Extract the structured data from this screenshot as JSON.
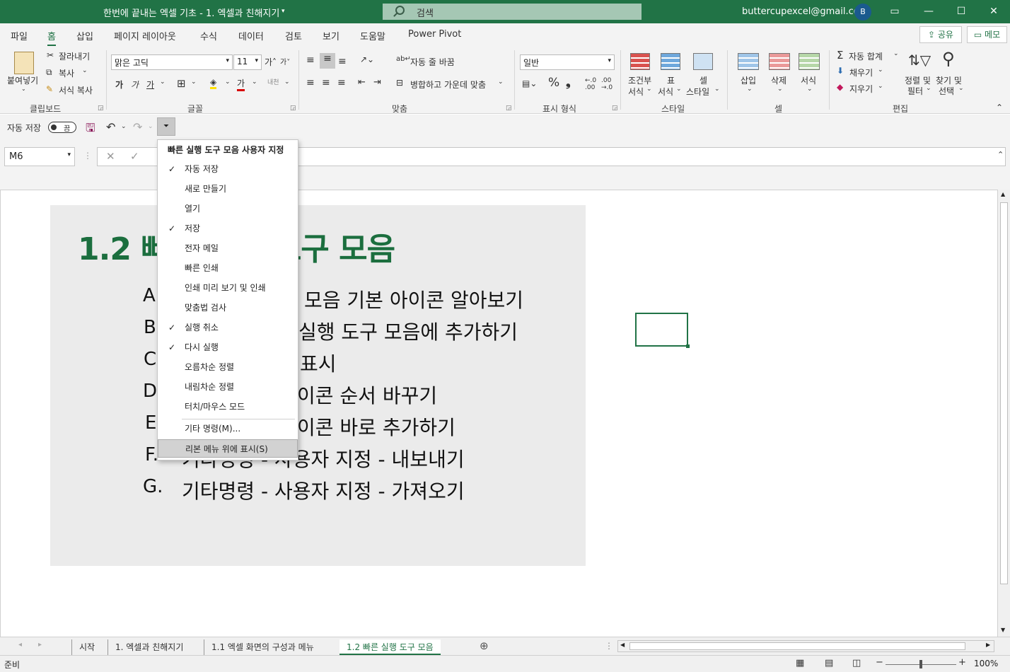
{
  "window": {
    "title": "한번에 끝내는 엑셀 기초 - 1. 엑셀과 친해지기",
    "search_placeholder": "검색",
    "account_email": "buttercupexcel@gmail.com",
    "avatar_initial": "B"
  },
  "menu_tabs": [
    "파일",
    "홈",
    "삽입",
    "페이지 레이아웃",
    "수식",
    "데이터",
    "검토",
    "보기",
    "도움말",
    "Power Pivot"
  ],
  "active_tab": "홈",
  "share_label": "공유",
  "memo_label": "메모",
  "ribbon": {
    "clipboard": {
      "paste": "붙여넣기",
      "cut": "잘라내기",
      "copy": "복사",
      "format_painter": "서식 복사",
      "group": "클립보드"
    },
    "font": {
      "name": "맑은 고딕",
      "size": "11",
      "bold": "가",
      "italic": "가",
      "underline": "가",
      "group": "글꼴"
    },
    "align": {
      "wrap": "자동 줄 바꿈",
      "merge": "병합하고 가운데 맞춤",
      "group": "맞춤"
    },
    "number": {
      "format": "일반",
      "group": "표시 형식"
    },
    "styles": {
      "cond1": "조건부",
      "cond2": "서식",
      "table1": "표",
      "table2": "서식",
      "cell1": "셀",
      "cell2": "스타일",
      "group": "스타일"
    },
    "cells": {
      "insert": "삽입",
      "delete": "삭제",
      "format": "서식",
      "group": "셀"
    },
    "edit": {
      "autosum": "자동 합계",
      "fill": "채우기",
      "clear": "지우기",
      "sort1": "정렬 및",
      "sort2": "필터",
      "find1": "찾기 및",
      "find2": "선택",
      "group": "편집"
    }
  },
  "qat": {
    "autosave_label": "자동 저장",
    "autosave_state": "끔"
  },
  "name_box": "M6",
  "slide": {
    "title": "1.2 빠른 실행 도구 모음",
    "letters": [
      "A",
      "B",
      "C",
      "D",
      "E",
      "F.",
      "G."
    ],
    "items_visible": [
      "모음 기본 아이콘 알아보기",
      "실행 도구 모음에 추가하기",
      "표시",
      "이콘 순서 바꾸기",
      "이콘 바로 추가하기",
      "기타명령 - 사용자 지정 - 내보내기",
      "기타명령 - 사용자 지정 - 가져오기"
    ]
  },
  "dropdown": {
    "header": "빠른 실행 도구 모음 사용자 지정",
    "items": [
      {
        "label": "자동 저장",
        "checked": true
      },
      {
        "label": "새로 만들기",
        "checked": false
      },
      {
        "label": "열기",
        "checked": false
      },
      {
        "label": "저장",
        "checked": true
      },
      {
        "label": "전자 메일",
        "checked": false
      },
      {
        "label": "빠른 인쇄",
        "checked": false
      },
      {
        "label": "인쇄 미리 보기 및 인쇄",
        "checked": false
      },
      {
        "label": "맞춤법 검사",
        "checked": false
      },
      {
        "label": "실행 취소",
        "checked": true
      },
      {
        "label": "다시 실행",
        "checked": true
      },
      {
        "label": "오름차순 정렬",
        "checked": false
      },
      {
        "label": "내림차순 정렬",
        "checked": false
      },
      {
        "label": "터치/마우스 모드",
        "checked": false
      }
    ],
    "more_commands": "기타 명령(M)...",
    "show_below": "리본 메뉴 위에 표시(S)"
  },
  "sheet_tabs": [
    "시작",
    "1. 엑셀과 친해지기",
    "1.1 엑셀 화면의 구성과 메뉴",
    "1.2 빠른 실행 도구 모음"
  ],
  "active_sheet": "1.2 빠른 실행 도구 모음",
  "status": {
    "ready": "준비",
    "zoom": "100%"
  },
  "colors": {
    "excel_green": "#217346",
    "title_green": "#1b6e3e"
  }
}
